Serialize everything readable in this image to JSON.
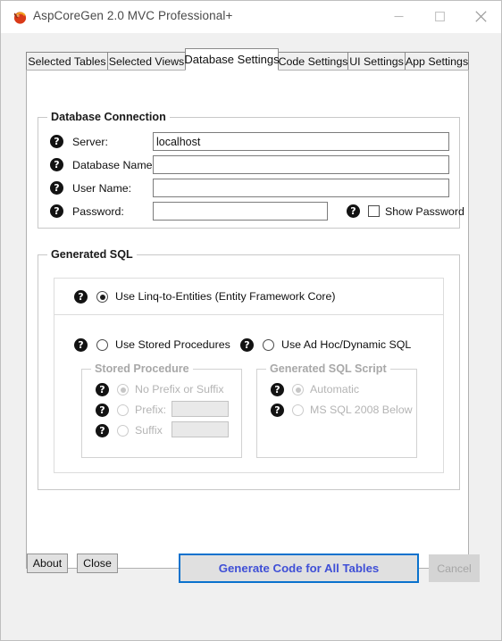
{
  "window": {
    "title": "AspCoreGen 2.0 MVC Professional+",
    "icon": "app-logo-icon",
    "controls": {
      "minimize": "minimize-icon",
      "maximize": "maximize-icon",
      "close": "close-icon"
    }
  },
  "tabs": [
    {
      "label": "Selected Tables",
      "active": false
    },
    {
      "label": "Selected Views",
      "active": false
    },
    {
      "label": "Database Settings",
      "active": true
    },
    {
      "label": "Code Settings",
      "active": false
    },
    {
      "label": "UI Settings",
      "active": false
    },
    {
      "label": "App Settings",
      "active": false
    }
  ],
  "database_connection": {
    "group_title": "Database Connection",
    "fields": [
      {
        "label": "Server:",
        "value": "localhost",
        "placeholder": ""
      },
      {
        "label": "Database Name:",
        "value": "",
        "placeholder": ""
      },
      {
        "label": "User Name:",
        "value": "",
        "placeholder": ""
      },
      {
        "label": "Password:",
        "value": "",
        "placeholder": ""
      }
    ],
    "show_password": {
      "label": "Show Password",
      "checked": false
    },
    "help_icon": "help-question-icon"
  },
  "generated_sql": {
    "group_title": "Generated SQL",
    "primary_option": {
      "label": "Use Linq-to-Entities (Entity Framework Core)",
      "checked": true
    },
    "secondary_options": [
      {
        "label": "Use Stored Procedures",
        "checked": false
      },
      {
        "label": "Use Ad Hoc/Dynamic SQL",
        "checked": false
      }
    ],
    "stored_procedure": {
      "group_title": "Stored Procedure",
      "enabled": false,
      "options": [
        {
          "label": "No Prefix or Suffix",
          "checked": true,
          "input": null
        },
        {
          "label": "Prefix:",
          "checked": false,
          "input": ""
        },
        {
          "label": "Suffix",
          "checked": false,
          "input": ""
        }
      ]
    },
    "generated_sql_script": {
      "group_title": "Generated SQL Script",
      "enabled": false,
      "options": [
        {
          "label": "Automatic",
          "checked": true
        },
        {
          "label": "MS SQL 2008  Below",
          "checked": false
        }
      ]
    }
  },
  "footer": {
    "about_label": "About",
    "close_label": "Close",
    "generate_label": "Generate Code for All Tables",
    "cancel_label": "Cancel"
  },
  "colors": {
    "primary_border": "#0a72cd",
    "primary_text": "#3f4fd6",
    "window_bg": "#f0f0f0",
    "page_bg": "#ffffff",
    "disabled_text": "#b4b4b4"
  }
}
